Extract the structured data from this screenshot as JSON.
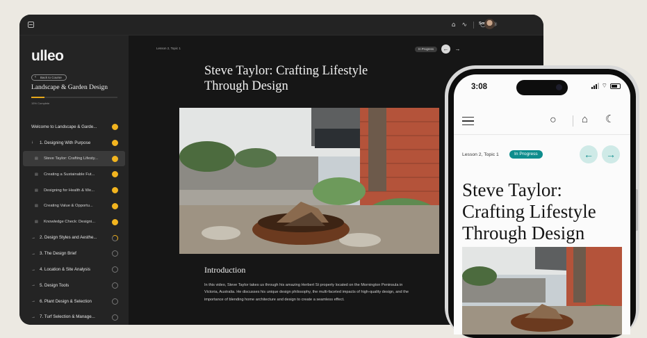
{
  "desktop": {
    "user_name": "Sonia",
    "logo": "ulleo",
    "back_label": "Back to Course",
    "course_title": "Landscape & Garden Design",
    "progress_text": "15% Complete",
    "progress_fraction": 0.15,
    "nav": [
      {
        "label": "Welcome to Landscape & Garde...",
        "kind": "top",
        "state": "done"
      },
      {
        "label": "1. Designing With Purpose",
        "kind": "chapter-open",
        "state": "done"
      },
      {
        "label": "Steve Taylor: Crafting Lifesty...",
        "kind": "sub",
        "state": "done",
        "active": true
      },
      {
        "label": "Creating a Sustainable Fut...",
        "kind": "sub",
        "state": "done"
      },
      {
        "label": "Designing for Health & We...",
        "kind": "sub",
        "state": "done"
      },
      {
        "label": "Creating Value & Opportu...",
        "kind": "sub",
        "state": "done"
      },
      {
        "label": "Knowledge Check: Designi...",
        "kind": "sub",
        "state": "done"
      },
      {
        "label": "2. Design Styles and Aesthe...",
        "kind": "chapter",
        "state": "partial"
      },
      {
        "label": "3. The Design Brief",
        "kind": "chapter",
        "state": "todo"
      },
      {
        "label": "4. Location & Site Analysis",
        "kind": "chapter",
        "state": "todo"
      },
      {
        "label": "5. Design Tools",
        "kind": "chapter",
        "state": "todo"
      },
      {
        "label": "6. Plant Design & Selection",
        "kind": "chapter",
        "state": "todo"
      },
      {
        "label": "7. Turf Selection & Manage...",
        "kind": "chapter",
        "state": "todo"
      }
    ],
    "breadcrumb": "Lesson 2, Topic 1",
    "status": "In Progress",
    "lesson_title": "Steve Taylor: Crafting Lifestyle Through Design",
    "section_title": "Introduction",
    "body": "In this video, Steve Taylor takes us through his amazing Herbert St property located on the Mornington Peninsula in Victoria, Australia. He discusses his unique design philosophy, the multi-faceted impacts of high-quality design, and the importance of blending home architecture and design to create a seamless effect."
  },
  "mobile": {
    "time": "3:08",
    "breadcrumb": "Lesson 2, Topic 1",
    "status": "In Progress",
    "lesson_title": "Steve Taylor: Crafting Lifestyle Through Design"
  },
  "colors": {
    "accent": "#f2b41f",
    "teal": "#0e8d8d",
    "dark": "#161616"
  }
}
